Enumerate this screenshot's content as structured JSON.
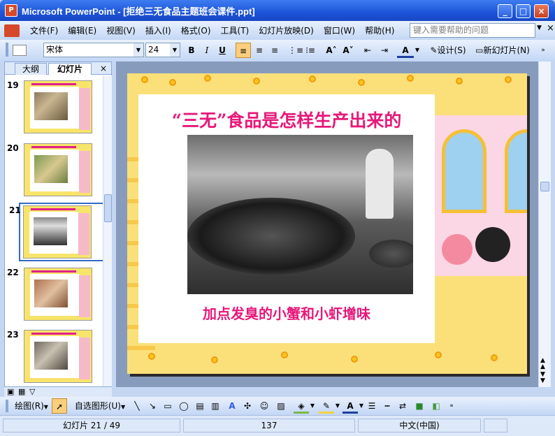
{
  "window": {
    "app_icon": "P",
    "title": "Microsoft PowerPoint - [拒绝三无食品主题班会课件.ppt]",
    "buttons": [
      "_",
      "□",
      "×"
    ]
  },
  "menu": {
    "items": [
      "文件(F)",
      "编辑(E)",
      "视图(V)",
      "插入(I)",
      "格式(O)",
      "工具(T)",
      "幻灯片放映(D)",
      "窗口(W)",
      "帮助(H)"
    ],
    "help_placeholder": "键入需要帮助的问题",
    "close_doc": "×"
  },
  "toolbar": {
    "font_name": "宋体",
    "font_size": "24",
    "bold": "B",
    "italic": "I",
    "underline": "U",
    "design_label": "设计(S)",
    "new_slide_label": "新幻灯片(N)"
  },
  "panel": {
    "tabs": [
      "大纲",
      "幻灯片"
    ],
    "close": "×",
    "selected_slide": "21",
    "thumbnails": [
      {
        "num": "19"
      },
      {
        "num": "20"
      },
      {
        "num": "21"
      },
      {
        "num": "22"
      },
      {
        "num": "23"
      }
    ]
  },
  "slide": {
    "title": "“三无”食品是怎样生产出来的",
    "caption": "加点发臭的小蟹和小虾增味",
    "photo_icon": "photo-crabs-in-wok"
  },
  "drawbar": {
    "draw_label": "绘图(R)",
    "autoshape_label": "自选图形(U)"
  },
  "status": {
    "slide_info": "幻灯片 21 / 49",
    "template": "137",
    "language": "中文(中国)"
  },
  "colors": {
    "title_pink": "#e6187a",
    "titlebar_blue": "#1d55d8"
  }
}
